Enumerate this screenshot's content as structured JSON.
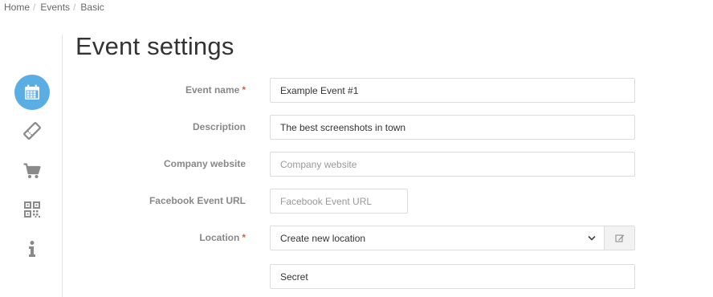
{
  "breadcrumb": {
    "items": [
      "Home",
      "Events",
      "Basic"
    ],
    "separator": "/"
  },
  "sidebar": {
    "items": [
      {
        "icon": "calendar-icon",
        "active": true
      },
      {
        "icon": "ticket-icon",
        "active": false
      },
      {
        "icon": "cart-icon",
        "active": false
      },
      {
        "icon": "qr-code-icon",
        "active": false
      },
      {
        "icon": "info-icon",
        "active": false
      }
    ],
    "active_color": "#5aaee4",
    "icon_color": "#8a8a8a"
  },
  "page": {
    "title": "Event settings"
  },
  "form": {
    "event_name": {
      "label": "Event name",
      "required_mark": "*",
      "value": "Example Event #1"
    },
    "description": {
      "label": "Description",
      "value": "The best screenshots in town"
    },
    "company_website": {
      "label": "Company website",
      "value": "",
      "placeholder": "Company website"
    },
    "facebook_url": {
      "label": "Facebook Event URL",
      "value": "",
      "placeholder": "Facebook Event URL"
    },
    "location": {
      "label": "Location",
      "required_mark": "*",
      "selected": "Create new location"
    },
    "secret": {
      "value": "Secret"
    }
  },
  "colors": {
    "required": "#e05c3e",
    "label": "#888888",
    "border": "#dcdcdc"
  }
}
